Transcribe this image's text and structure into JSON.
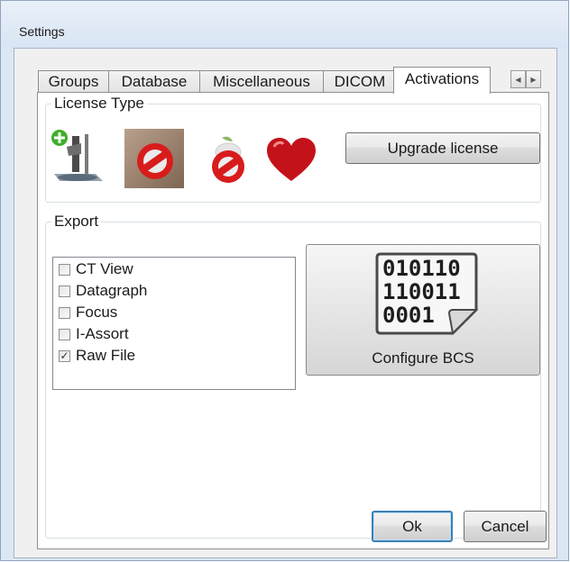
{
  "window": {
    "title": "Settings"
  },
  "tabs": [
    "Groups",
    "Database",
    "Miscellaneous",
    "DICOM",
    "Activations"
  ],
  "active_tab": "Activations",
  "license": {
    "group_label": "License Type",
    "upgrade_button": "Upgrade license",
    "icons": [
      "add-device-icon",
      "disabled-scanner-icon",
      "disabled-apple-icon",
      "heart-icon"
    ]
  },
  "export": {
    "group_label": "Export",
    "items": [
      {
        "label": "CT View",
        "checked": false
      },
      {
        "label": "Datagraph",
        "checked": false
      },
      {
        "label": "Focus",
        "checked": false
      },
      {
        "label": "I-Assort",
        "checked": false
      },
      {
        "label": "Raw File",
        "checked": true
      }
    ],
    "bcs_icon_lines": [
      "010110",
      "110011",
      "0001"
    ],
    "configure_label": "Configure BCS"
  },
  "footer": {
    "ok": "Ok",
    "cancel": "Cancel"
  },
  "colors": {
    "heart": "#c4121a",
    "no_sign": "#d81c1c",
    "title_bg": "#dce7f4"
  }
}
